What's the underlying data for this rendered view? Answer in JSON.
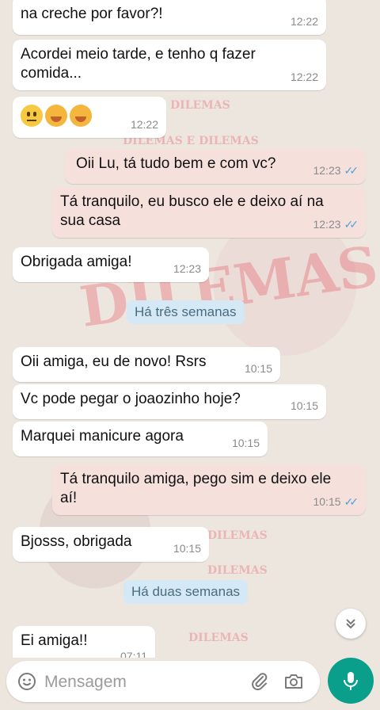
{
  "watermarks": [
    "DILEMAS",
    "DILEMAS E DILEMAS",
    "DILEMAS",
    "DILEMAS",
    "DILEMAS",
    "DILEMAS"
  ],
  "messages": [
    {
      "dir": "in",
      "text": "na creche por favor?!",
      "time": "12:22"
    },
    {
      "dir": "in",
      "text": "Acordei meio tarde, e tenho q fazer comida...",
      "time": "12:22"
    },
    {
      "dir": "in",
      "emoji": [
        "neutral-face",
        "hugging-face",
        "hugging-face"
      ],
      "time": "12:22"
    },
    {
      "dir": "out",
      "text": "Oii Lu, tá tudo bem e com vc?",
      "time": "12:23",
      "ticks": "✓✓"
    },
    {
      "dir": "out",
      "text": "Tá tranquilo, eu busco ele e deixo aí na sua casa",
      "time": "12:23",
      "ticks": "✓✓"
    },
    {
      "dir": "in",
      "text": "Obrigada amiga!",
      "time": "12:23"
    },
    {
      "dir": "in",
      "text": "Oii amiga, eu de novo! Rsrs",
      "time": "10:15"
    },
    {
      "dir": "in",
      "text": "Vc pode pegar o joaozinho hoje?",
      "time": "10:15"
    },
    {
      "dir": "in",
      "text": "Marquei manicure agora",
      "time": "10:15"
    },
    {
      "dir": "out",
      "text": "Tá tranquilo amiga, pego sim e deixo ele aí!",
      "time": "10:15",
      "ticks": "✓✓"
    },
    {
      "dir": "in",
      "text": "Bjosss, obrigada",
      "time": "10:15"
    },
    {
      "dir": "in",
      "text": "Ei amiga!!",
      "time": "07:11"
    }
  ],
  "date_labels": [
    "Há três semanas",
    "Há duas semanas"
  ],
  "composer": {
    "placeholder": "Mensagem"
  },
  "icons": {
    "emoji": "emoji-icon",
    "attach": "paperclip-icon",
    "camera": "camera-icon",
    "mic": "microphone-icon",
    "scroll": "chevron-double-down-icon"
  },
  "colors": {
    "incoming": "#ffffff",
    "outgoing": "#f6e0dc",
    "date_chip": "#d4e9f5",
    "mic": "#0a9f8a",
    "ticks": "#4fa3e0"
  }
}
